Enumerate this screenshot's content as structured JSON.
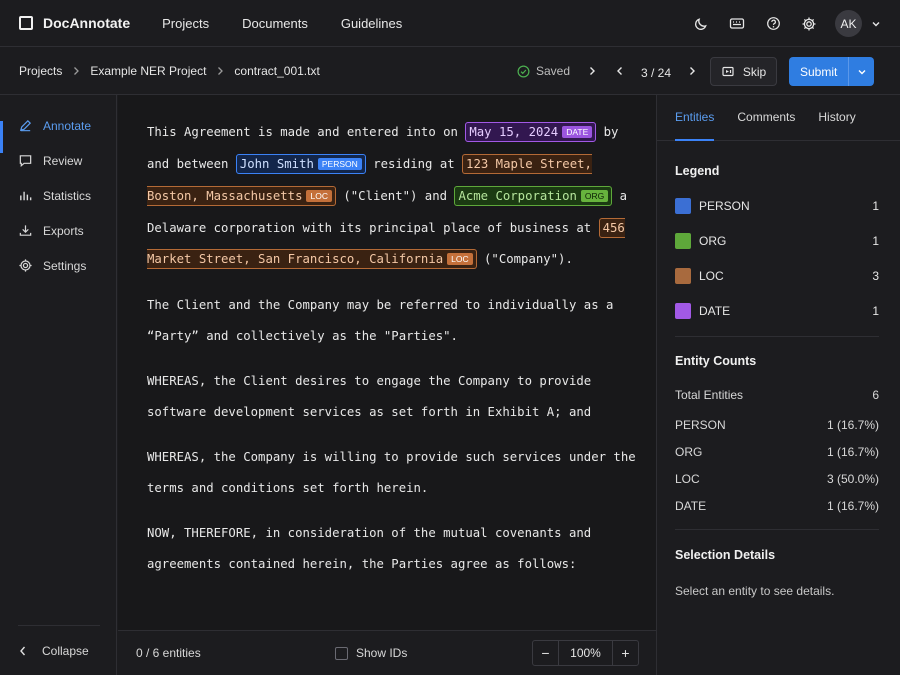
{
  "app": {
    "name": "DocAnnotate",
    "user_initials": "AK"
  },
  "topnav": [
    "Projects",
    "Documents",
    "Guidelines"
  ],
  "breadcrumb": [
    "Projects",
    "Example NER Project",
    "contract_001.txt"
  ],
  "status": {
    "saved": "Saved"
  },
  "pager": {
    "position": "3 / 24"
  },
  "actions": {
    "skip": "Skip",
    "submit": "Submit"
  },
  "sidebar": {
    "items": [
      {
        "label": "Annotate",
        "icon": "pencil-icon",
        "active": true
      },
      {
        "label": "Review",
        "icon": "chat-icon",
        "active": false
      },
      {
        "label": "Statistics",
        "icon": "bar-chart-icon",
        "active": false
      },
      {
        "label": "Exports",
        "icon": "download-icon",
        "active": false
      },
      {
        "label": "Settings",
        "icon": "gear-icon",
        "active": false
      }
    ],
    "collapse": "Collapse"
  },
  "document": {
    "paragraphs": [
      [
        {
          "t": "This Agreement is made and entered into on "
        },
        {
          "t": "May 15, 2024",
          "label": "DATE",
          "cls": "date"
        },
        {
          "t": " by and between "
        },
        {
          "t": "John Smith",
          "label": "PERSON",
          "cls": "person"
        },
        {
          "t": " residing at "
        },
        {
          "t": "123 Maple Street, Boston, Massachusetts",
          "label": "LOC",
          "cls": "loc"
        },
        {
          "t": " (\"Client\") and "
        },
        {
          "t": "Acme Corporation",
          "label": "ORG",
          "cls": "org"
        },
        {
          "t": " a Delaware corporation with its principal place of business at "
        },
        {
          "t": "456 Market Street, San Francisco, California",
          "label": "LOC",
          "cls": "loc"
        },
        {
          "t": " (\"Company\")."
        }
      ],
      [
        {
          "t": "The Client and the Company may be referred to individually as a “Party” and collectively as the \"Parties\"."
        }
      ],
      [
        {
          "t": "WHEREAS, the Client desires to engage the Company to provide software development services as set forth in Exhibit A; and"
        }
      ],
      [
        {
          "t": "WHEREAS, the Company is willing to provide such services under the terms and conditions set forth herein."
        }
      ],
      [
        {
          "t": "NOW, THEREFORE, in consideration of the mutual covenants and agreements contained herein, the Parties agree as follows:"
        }
      ]
    ]
  },
  "footer": {
    "entity_count": "0 / 6 entities",
    "show_ids": "Show IDs",
    "zoom": "100%"
  },
  "panel": {
    "tabs": [
      "Entities",
      "Comments",
      "History"
    ],
    "legend_title": "Legend",
    "legend": [
      {
        "label": "PERSON",
        "count": "1",
        "color": "#3b6fd4"
      },
      {
        "label": "ORG",
        "count": "1",
        "color": "#5ea83a"
      },
      {
        "label": "LOC",
        "count": "3",
        "color": "#a86a3e"
      },
      {
        "label": "DATE",
        "count": "1",
        "color": "#a259e6"
      }
    ],
    "counts_title": "Entity Counts",
    "total_label": "Total Entities",
    "total_value": "6",
    "counts": [
      {
        "label": "PERSON",
        "value": "1 (16.7%)"
      },
      {
        "label": "ORG",
        "value": "1 (16.7%)"
      },
      {
        "label": "LOC",
        "value": "3 (50.0%)"
      },
      {
        "label": "DATE",
        "value": "1 (16.7%)"
      }
    ],
    "selection_title": "Selection Details",
    "selection_hint": "Select an entity to see details."
  }
}
